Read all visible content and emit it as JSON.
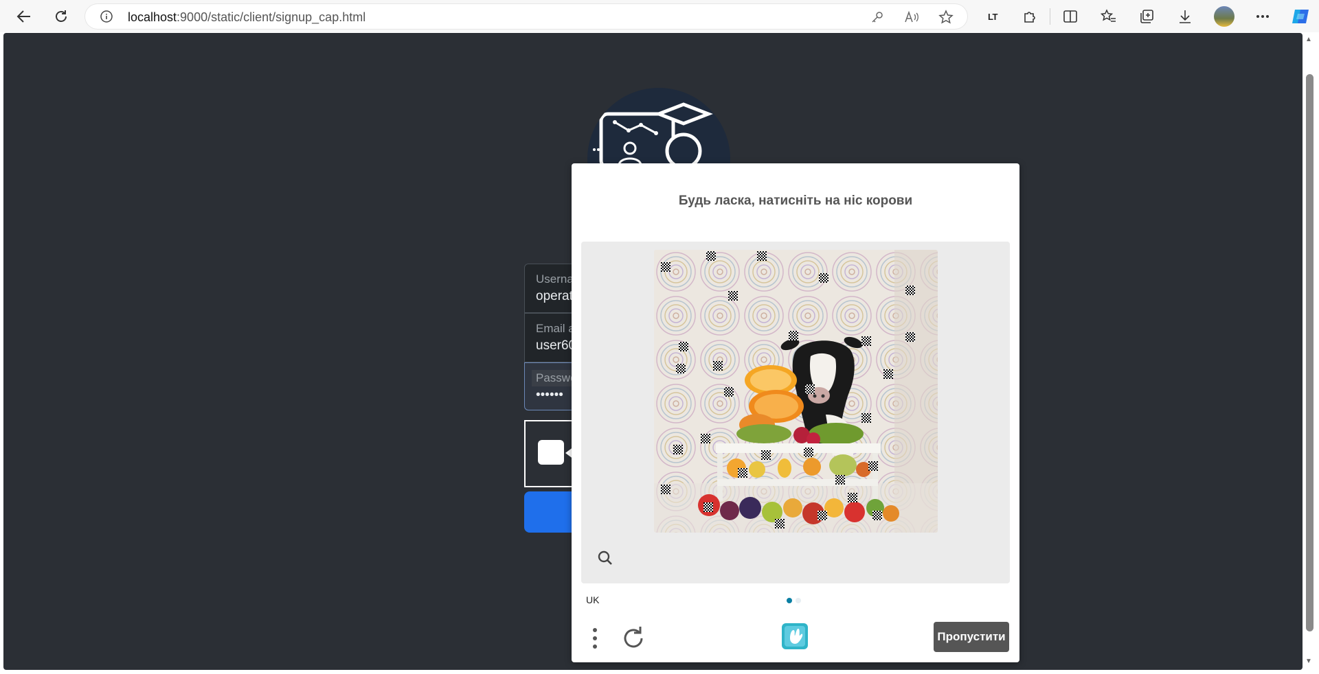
{
  "browser": {
    "url_host": "localhost",
    "url_path": ":9000/static/client/signup_cap.html",
    "lt_label": "LT"
  },
  "form": {
    "username_label": "Userna",
    "username_value": "operat",
    "email_label": "Email a",
    "email_value": "user60",
    "password_label": "Passwo",
    "password_value": "••••••"
  },
  "captcha": {
    "prompt": "Будь ласка, натисніть на ніс корови",
    "language": "UK",
    "skip_label": "Пропустити",
    "active_page": 1,
    "page_count": 2,
    "accent_color": "#0a7fa3"
  },
  "icons": [
    "back-icon",
    "reload-icon",
    "info-icon",
    "key-icon",
    "read-aloud-icon",
    "favorite-star-icon",
    "extensions-icon",
    "split-screen-icon",
    "favorites-icon",
    "collections-icon",
    "downloads-icon",
    "more-icon",
    "copilot-icon",
    "zoom-icon",
    "menu-dots-icon",
    "refresh-icon",
    "hcaptcha-logo-icon",
    "camera-icon"
  ]
}
